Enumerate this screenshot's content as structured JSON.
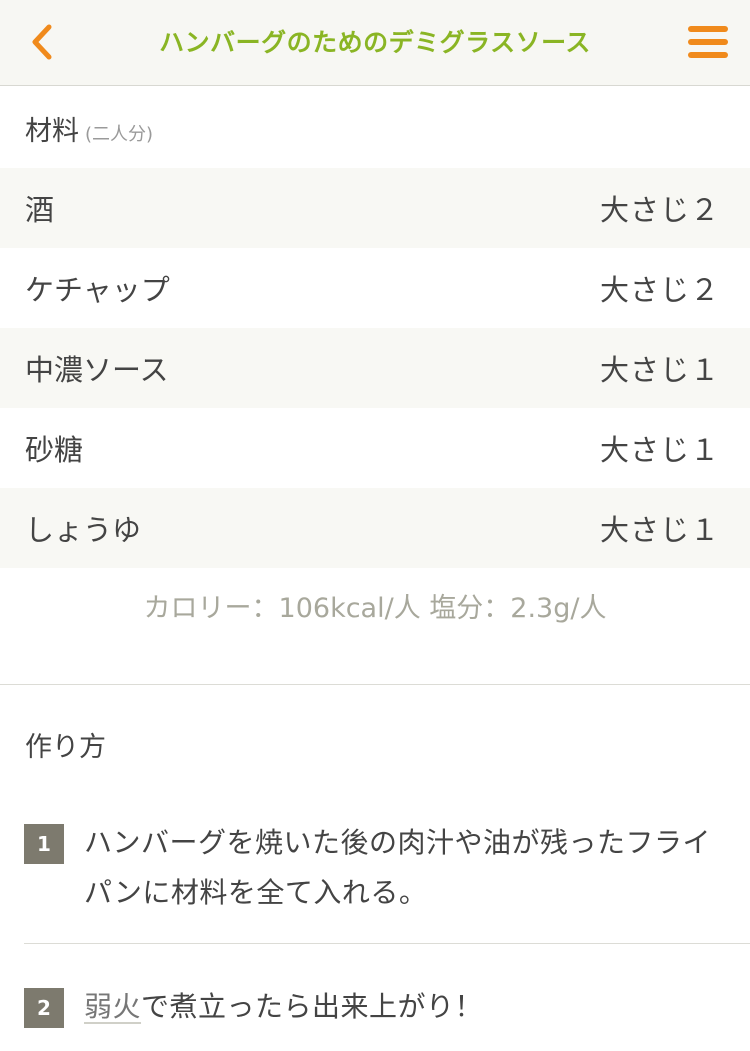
{
  "header": {
    "title": "ハンバーグのためのデミグラスソース",
    "back_icon": "chevron-left-icon",
    "menu_icon": "hamburger-menu-icon",
    "title_color": "#8ab524",
    "accent_color": "#f08a1c"
  },
  "ingredients": {
    "heading": "材料",
    "servings": "(二人分)",
    "items": [
      {
        "name": "酒",
        "amount": "大さじ２"
      },
      {
        "name": "ケチャップ",
        "amount": "大さじ２"
      },
      {
        "name": "中濃ソース",
        "amount": "大さじ１"
      },
      {
        "name": "砂糖",
        "amount": "大さじ１"
      },
      {
        "name": "しょうゆ",
        "amount": "大さじ１"
      }
    ],
    "nutrition": "カロリー：106kcal/人 塩分：2.3g/人"
  },
  "steps": {
    "heading": "作り方",
    "items": [
      {
        "number": "1",
        "text": "ハンバーグを焼いた後の肉汁や油が残ったフライパンに材料を全て入れる。"
      },
      {
        "number": "2",
        "term": "弱火",
        "text": "で煮立ったら出来上がり！"
      }
    ]
  }
}
